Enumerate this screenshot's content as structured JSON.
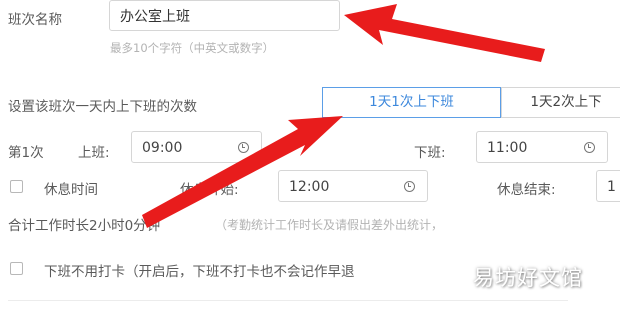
{
  "shift": {
    "name_label": "班次名称",
    "name_value": "办公室上班",
    "name_hint": "最多10个字符（中英文或数字）"
  },
  "times_setting": {
    "label": "设置该班次一天内上下班的次数",
    "options": [
      "1天1次上下班",
      "1天2次上下"
    ],
    "selected": "1天1次上下班"
  },
  "first": {
    "label": "第1次",
    "on_label": "上班:",
    "on_time": "09:00",
    "off_label": "下班:",
    "off_time": "11:00"
  },
  "rest": {
    "label": "休息时间",
    "start_label": "休息开始:",
    "start_time": "12:00",
    "end_label": "休息结束:",
    "end_time": "1"
  },
  "total": {
    "text": "合计工作时长2小时0分钟",
    "hint": "（考勤统计工作时长及请假出差外出统计，"
  },
  "offduty": {
    "label": "下班不用打卡（开启后，下班不打卡也不会记作早退"
  },
  "watermark": "易坊好文馆",
  "colors": {
    "accent": "#3d88dc",
    "arrow": "#e81c1c"
  },
  "icons": {
    "time": "clock-icon",
    "checkbox": "checkbox-icon"
  }
}
